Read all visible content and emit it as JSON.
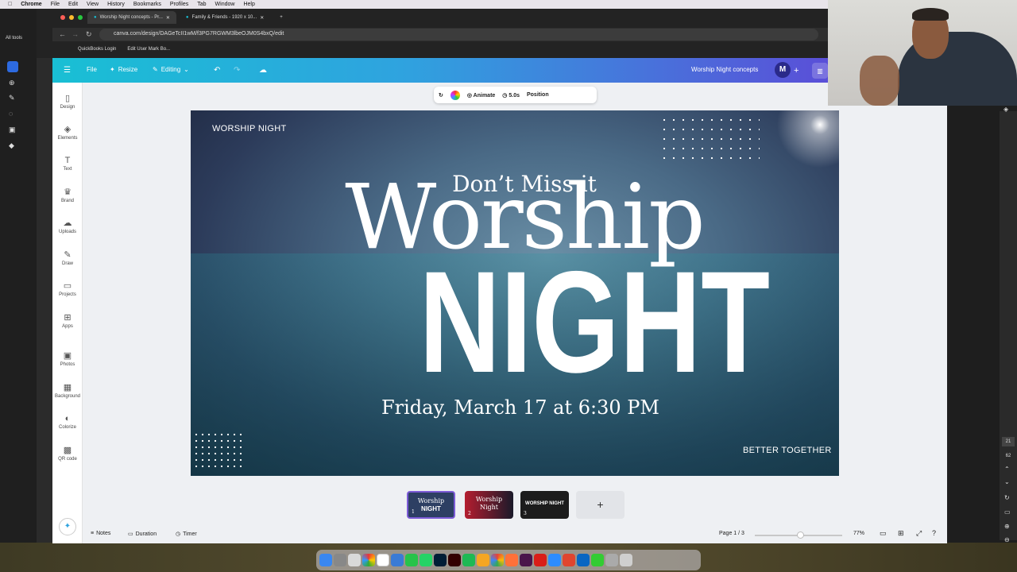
{
  "mac_menu": {
    "apple": "",
    "app": "Chrome",
    "items": [
      "File",
      "Edit",
      "View",
      "History",
      "Bookmarks",
      "Profiles",
      "Tab",
      "Window",
      "Help"
    ]
  },
  "left_panel": {
    "all_tools": "All tools"
  },
  "browser": {
    "tabs": [
      {
        "label": "Worship Night concepts - Pr..."
      },
      {
        "label": "Family & Friends - 1920 x 10..."
      }
    ],
    "new_tab": "+",
    "url": "canva.com/design/DAGeTcII1wM/f3PG7RGWM3lbeOJM0S4bxQ/edit",
    "bookmarks": [
      "QuickBooks Login",
      "Edit User Mark Bo..."
    ]
  },
  "canva_header": {
    "menu_icon": "hamburger-icon",
    "file": "File",
    "resize": "Resize",
    "editing": "Editing",
    "design_title": "Worship Night concepts",
    "avatar_initial": "M",
    "plus": "+"
  },
  "sidenav": {
    "items": [
      {
        "label": "Design",
        "icon": "▯"
      },
      {
        "label": "Elements",
        "icon": "◈"
      },
      {
        "label": "Text",
        "icon": "T"
      },
      {
        "label": "Brand",
        "icon": "♛"
      },
      {
        "label": "Uploads",
        "icon": "☁"
      },
      {
        "label": "Draw",
        "icon": "✎"
      },
      {
        "label": "Projects",
        "icon": "▭"
      },
      {
        "label": "Apps",
        "icon": "⊞"
      },
      {
        "label": "Photos",
        "icon": "▣"
      },
      {
        "label": "Background",
        "icon": "▦"
      },
      {
        "label": "Colorize",
        "icon": "◐"
      },
      {
        "label": "QR code",
        "icon": "▩"
      }
    ]
  },
  "context_toolbar": {
    "animate": "Animate",
    "duration": "5.0s",
    "position": "Position"
  },
  "design": {
    "corner_top_left": "WORSHIP NIGHT",
    "tagline": "Don’t Miss it",
    "headline_1": "Worship",
    "headline_2": "NIGHT",
    "date_time": "Friday, March 17 at 6:30 PM",
    "corner_bottom_right": "BETTER TOGETHER"
  },
  "pages": [
    {
      "number": "1",
      "title_a": "Worship",
      "title_b": "NIGHT"
    },
    {
      "number": "2",
      "title_a": "Worship",
      "title_b": "Night"
    },
    {
      "number": "3",
      "title_a": "WORSHIP NIGHT",
      "title_b": ""
    }
  ],
  "add_page": "+",
  "bottom_bar": {
    "notes": "Notes",
    "duration": "Duration",
    "timer": "Timer",
    "page_indicator": "Page 1 / 3",
    "zoom": "77%",
    "zoom_level": 0.77
  },
  "right_strip": {
    "numbers": [
      "21",
      "62"
    ]
  }
}
